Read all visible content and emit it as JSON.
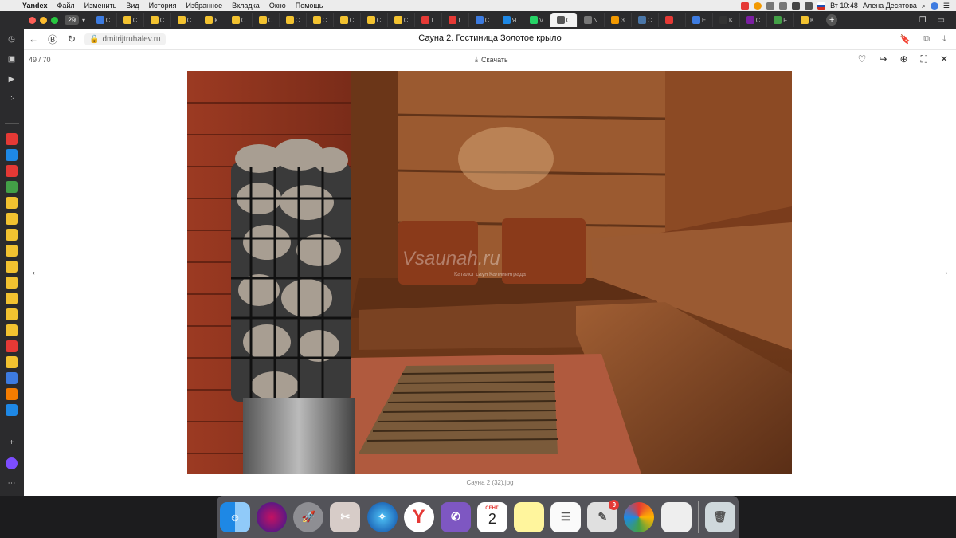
{
  "menubar": {
    "app": "Yandex",
    "items": [
      "Файл",
      "Изменить",
      "Вид",
      "История",
      "Избранное",
      "Вкладка",
      "Окно",
      "Помощь"
    ],
    "time": "Вт 10:48",
    "user": "Алена Десятова"
  },
  "tabstrip": {
    "tab_count": "29",
    "tabs": [
      {
        "color": "#3d7be0",
        "label": "С",
        "icon": "mail-icon"
      },
      {
        "color": "#f2c230",
        "label": "С",
        "icon": "star-icon"
      },
      {
        "color": "#f2c230",
        "label": "С",
        "icon": "star-icon"
      },
      {
        "color": "#f2c230",
        "label": "С",
        "icon": "star-icon"
      },
      {
        "color": "#f2c230",
        "label": "К",
        "icon": "star-icon"
      },
      {
        "color": "#f2c230",
        "label": "С",
        "icon": "star-icon"
      },
      {
        "color": "#f2c230",
        "label": "С",
        "icon": "star-icon"
      },
      {
        "color": "#f2c230",
        "label": "С",
        "icon": "star-icon"
      },
      {
        "color": "#f2c230",
        "label": "С",
        "icon": "star-icon"
      },
      {
        "color": "#f2c230",
        "label": "С",
        "icon": "star-icon"
      },
      {
        "color": "#f2c230",
        "label": "С",
        "icon": "star-icon"
      },
      {
        "color": "#f2c230",
        "label": "С",
        "icon": "star-icon"
      },
      {
        "color": "#e53935",
        "label": "Г",
        "icon": "star-icon"
      },
      {
        "color": "#e53935",
        "label": "Г",
        "icon": "star-icon"
      },
      {
        "color": "#3d7be0",
        "label": "С",
        "icon": "map-icon"
      },
      {
        "color": "#1e88e5",
        "label": "Я",
        "icon": "wave-icon"
      },
      {
        "color": "#25d366",
        "label": "V",
        "icon": "whatsapp-icon"
      },
      {
        "color": "#555555",
        "label": "С",
        "icon": "photo-icon"
      },
      {
        "color": "#777777",
        "label": "N",
        "icon": "cloud-icon"
      },
      {
        "color": "#f29900",
        "label": "З",
        "icon": "globe-icon"
      },
      {
        "color": "#4a76a8",
        "label": "С",
        "icon": "vk-icon"
      },
      {
        "color": "#e53935",
        "label": "Г",
        "icon": "flag-icon"
      },
      {
        "color": "#3d7be0",
        "label": "Е",
        "icon": "doc-icon"
      },
      {
        "color": "#333333",
        "label": "K",
        "icon": "app-icon"
      },
      {
        "color": "#7b1fa2",
        "label": "С",
        "icon": "app-icon"
      },
      {
        "color": "#43a047",
        "label": "F",
        "icon": "app-icon"
      },
      {
        "color": "#f2c230",
        "label": "K",
        "icon": "star-icon"
      }
    ]
  },
  "toolbar": {
    "url": "dmitrijtruhalev.ru",
    "page_title": "Сауна 2. Гостиница Золотое крыло"
  },
  "viewer": {
    "counter": "49 / 70",
    "download_label": "Скачать",
    "watermark": "Vsaunah.ru",
    "watermark_sub": "Каталог саун Калининграда",
    "caption": "Сауна 2 (32).jpg"
  },
  "dock": {
    "calendar_month": "СЕНТ.",
    "calendar_day": "2",
    "notification_badge": "9"
  }
}
